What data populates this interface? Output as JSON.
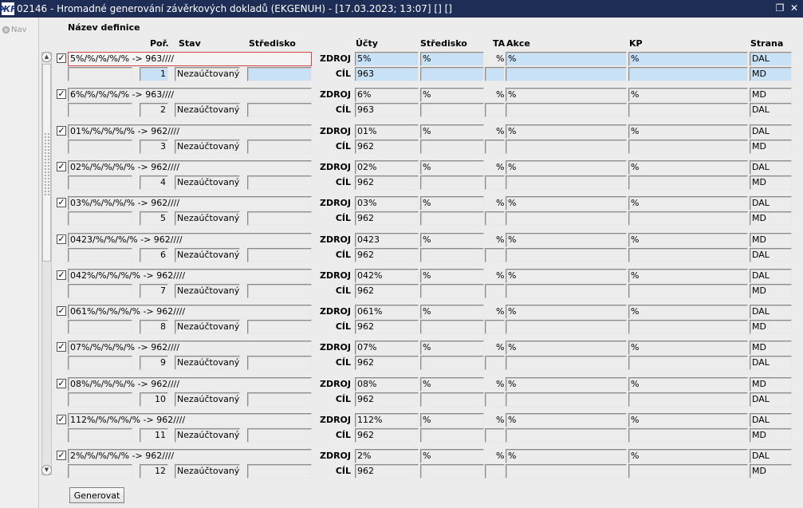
{
  "window": {
    "title": "02146 - Hromadné generování závěrkových dokladů (EKGENUH) - [17.03.2023; 13:07] [] []",
    "icon_text": "ЖF"
  },
  "nav": {
    "label": "Nav"
  },
  "headers": {
    "nazev": "Název definice",
    "por": "Poř.",
    "stav": "Stav",
    "stredisko_left": "Středisko",
    "ucty": "Účty",
    "stredisko": "Středisko",
    "ta": "TA",
    "akce": "Akce",
    "kp": "KP",
    "strana": "Strana"
  },
  "labels": {
    "zdroj": "ZDROJ",
    "cil": "CÍL",
    "pct": "%"
  },
  "rows": [
    {
      "name": "5%/%/%/%/% -> 963////",
      "por": "1",
      "stav": "Nezaúčtovaný",
      "zdroj_ucet": "5%",
      "cil_ucet": "963",
      "stredisko": "%",
      "akce": "%",
      "kp": "%",
      "zdroj_strana": "DAL",
      "cil_strana": "MD",
      "checked": true
    },
    {
      "name": "6%/%/%/%/% -> 963////",
      "por": "2",
      "stav": "Nezaúčtovaný",
      "zdroj_ucet": "6%",
      "cil_ucet": "963",
      "stredisko": "%",
      "akce": "%",
      "kp": "%",
      "zdroj_strana": "MD",
      "cil_strana": "DAL",
      "checked": true
    },
    {
      "name": "01%/%/%/%/% -> 962////",
      "por": "3",
      "stav": "Nezaúčtovaný",
      "zdroj_ucet": "01%",
      "cil_ucet": "962",
      "stredisko": "%",
      "akce": "%",
      "kp": "%",
      "zdroj_strana": "DAL",
      "cil_strana": "MD",
      "checked": true
    },
    {
      "name": "02%/%/%/%/% -> 962////",
      "por": "4",
      "stav": "Nezaúčtovaný",
      "zdroj_ucet": "02%",
      "cil_ucet": "962",
      "stredisko": "%",
      "akce": "%",
      "kp": "%",
      "zdroj_strana": "DAL",
      "cil_strana": "MD",
      "checked": true
    },
    {
      "name": "03%/%/%/%/% -> 962////",
      "por": "5",
      "stav": "Nezaúčtovaný",
      "zdroj_ucet": "03%",
      "cil_ucet": "962",
      "stredisko": "%",
      "akce": "%",
      "kp": "%",
      "zdroj_strana": "DAL",
      "cil_strana": "MD",
      "checked": true
    },
    {
      "name": "0423/%/%/%/% -> 962////",
      "por": "6",
      "stav": "Nezaúčtovaný",
      "zdroj_ucet": "0423",
      "cil_ucet": "962",
      "stredisko": "%",
      "akce": "%",
      "kp": "%",
      "zdroj_strana": "MD",
      "cil_strana": "DAL",
      "checked": true
    },
    {
      "name": "042%/%/%/%/% -> 962////",
      "por": "7",
      "stav": "Nezaúčtovaný",
      "zdroj_ucet": "042%",
      "cil_ucet": "962",
      "stredisko": "%",
      "akce": "%",
      "kp": "%",
      "zdroj_strana": "DAL",
      "cil_strana": "MD",
      "checked": true
    },
    {
      "name": "061%/%/%/%/% -> 962////",
      "por": "8",
      "stav": "Nezaúčtovaný",
      "zdroj_ucet": "061%",
      "cil_ucet": "962",
      "stredisko": "%",
      "akce": "%",
      "kp": "%",
      "zdroj_strana": "DAL",
      "cil_strana": "MD",
      "checked": true
    },
    {
      "name": "07%/%/%/%/% -> 962////",
      "por": "9",
      "stav": "Nezaúčtovaný",
      "zdroj_ucet": "07%",
      "cil_ucet": "962",
      "stredisko": "%",
      "akce": "%",
      "kp": "%",
      "zdroj_strana": "MD",
      "cil_strana": "DAL",
      "checked": true
    },
    {
      "name": "08%/%/%/%/% -> 962////",
      "por": "10",
      "stav": "Nezaúčtovaný",
      "zdroj_ucet": "08%",
      "cil_ucet": "962",
      "stredisko": "%",
      "akce": "%",
      "kp": "%",
      "zdroj_strana": "MD",
      "cil_strana": "DAL",
      "checked": true
    },
    {
      "name": "112%/%/%/%/% -> 962////",
      "por": "11",
      "stav": "Nezaúčtovaný",
      "zdroj_ucet": "112%",
      "cil_ucet": "962",
      "stredisko": "%",
      "akce": "%",
      "kp": "%",
      "zdroj_strana": "DAL",
      "cil_strana": "MD",
      "checked": true
    },
    {
      "name": "2%/%/%/%/% -> 962////",
      "por": "12",
      "stav": "Nezaúčtovaný",
      "zdroj_ucet": "2%",
      "cil_ucet": "962",
      "stredisko": "%",
      "akce": "%",
      "kp": "%",
      "zdroj_strana": "DAL",
      "cil_strana": "MD",
      "checked": true
    }
  ],
  "buttons": {
    "generate": "Generovat"
  },
  "colors": {
    "titlebar": "#1e2d55",
    "highlight": "#c8e1f7",
    "focus_border": "#d24848"
  }
}
